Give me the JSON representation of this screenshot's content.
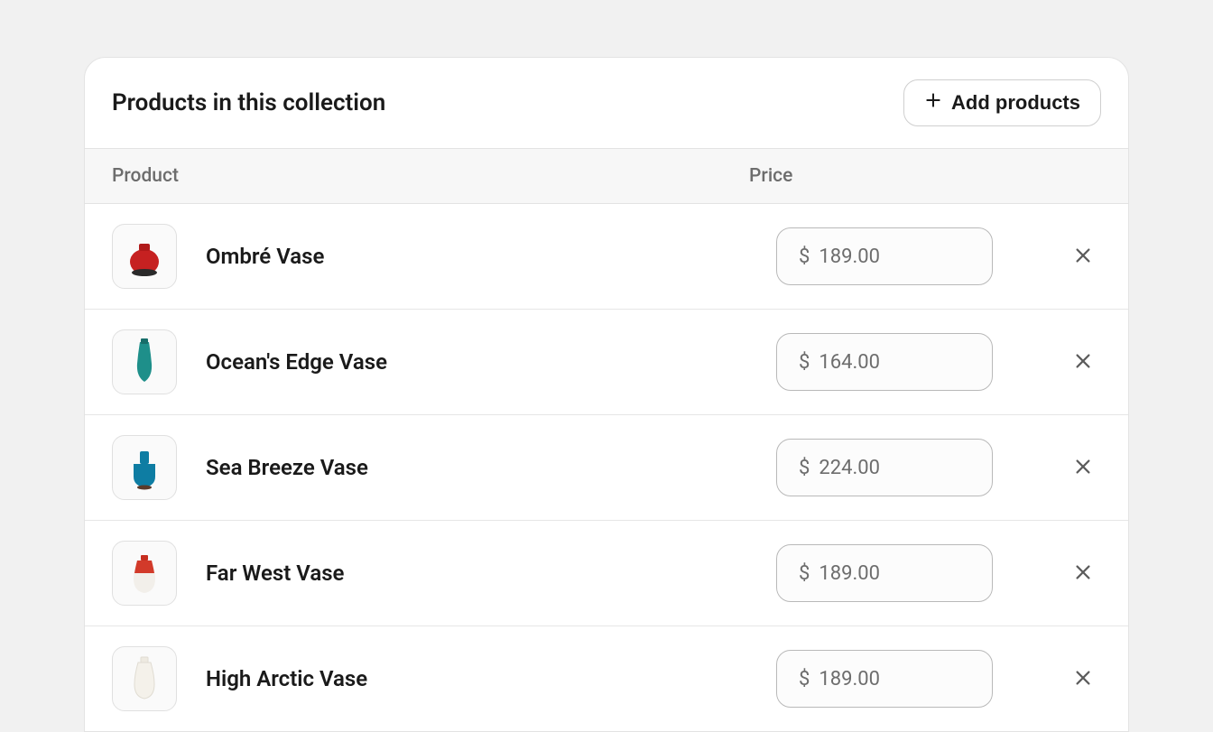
{
  "header": {
    "title": "Products in this collection",
    "add_label": "Add products"
  },
  "columns": {
    "product": "Product",
    "price": "Price"
  },
  "currency": "$",
  "products": [
    {
      "name": "Ombré Vase",
      "price": "189.00",
      "thumb": "red-round"
    },
    {
      "name": "Ocean's Edge Vase",
      "price": "164.00",
      "thumb": "teal-tall"
    },
    {
      "name": "Sea Breeze Vase",
      "price": "224.00",
      "thumb": "teal-squat"
    },
    {
      "name": "Far West Vase",
      "price": "189.00",
      "thumb": "red-white"
    },
    {
      "name": "High Arctic Vase",
      "price": "189.00",
      "thumb": "white"
    }
  ]
}
